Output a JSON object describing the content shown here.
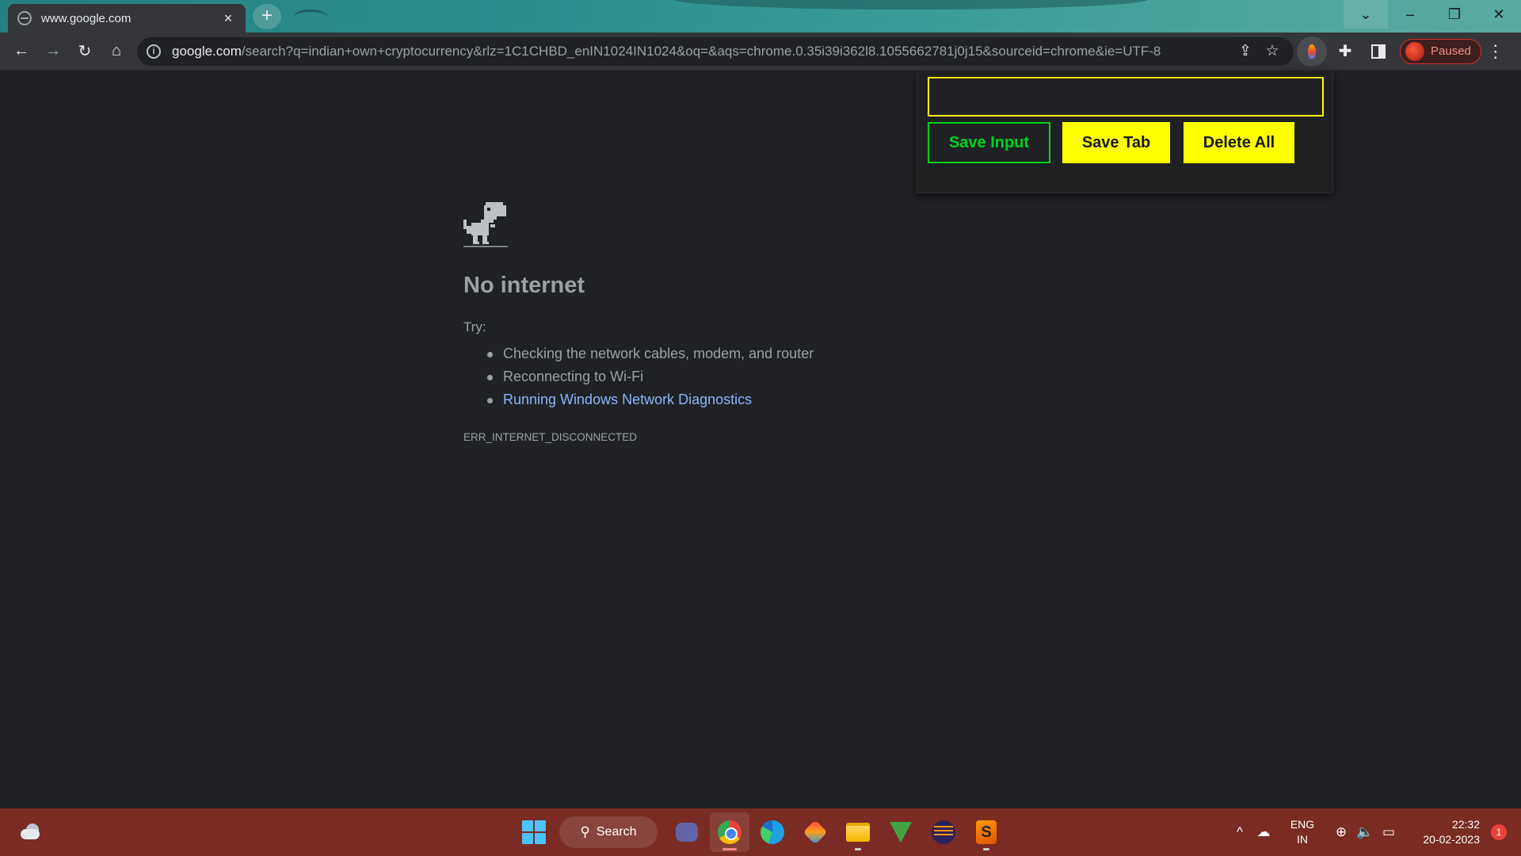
{
  "browser": {
    "tab": {
      "title": "www.google.com",
      "close_glyph": "×"
    },
    "new_tab_glyph": "+",
    "window_controls": {
      "tab_search_glyph": "⌄",
      "minimize_glyph": "–",
      "restore_glyph": "❐",
      "close_glyph": "✕"
    },
    "toolbar": {
      "back_glyph": "←",
      "forward_glyph": "→",
      "reload_glyph": "↻",
      "home_glyph": "⌂",
      "info_glyph": "i",
      "url_host": "google.com",
      "url_rest": "/search?q=indian+own+cryptocurrency&rlz=1C1CHBD_enIN1024IN1024&oq=&aqs=chrome.0.35i39i362l8.1055662781j0j15&sourceid=chrome&ie=UTF-8",
      "share_glyph": "⇪",
      "bookmark_glyph": "☆",
      "extensions_glyph": "✚",
      "profile_status": "Paused",
      "menu_glyph": "⋮"
    }
  },
  "popup": {
    "input_value": "",
    "save_input_label": "Save Input",
    "save_tab_label": "Save Tab",
    "delete_all_label": "Delete All",
    "colors": {
      "accent_yellow": "#ffff00",
      "accent_green": "#00d21c"
    }
  },
  "error_page": {
    "heading": "No internet",
    "try_label": "Try:",
    "suggestions": [
      "Checking the network cables, modem, and router",
      "Reconnecting to Wi-Fi",
      "Running Windows Network Diagnostics"
    ],
    "error_code": "ERR_INTERNET_DISCONNECTED"
  },
  "taskbar": {
    "search_label": "Search",
    "search_glyph": "⚲",
    "apps": [
      "teams-meet-icon",
      "chrome-icon",
      "edge-icon",
      "paint-icon",
      "file-explorer-icon",
      "vim-icon",
      "eclipse-icon",
      "sublime-text-icon"
    ],
    "sublime_glyph": "S",
    "tray": {
      "chevron_glyph": "^",
      "onedrive_glyph": "☁",
      "lang_line1": "ENG",
      "lang_line2": "IN",
      "network_glyph": "⊕",
      "volume_glyph": "🔈",
      "battery_glyph": "▭",
      "time": "22:32",
      "date": "20-02-2023",
      "notification_count": "1"
    }
  }
}
